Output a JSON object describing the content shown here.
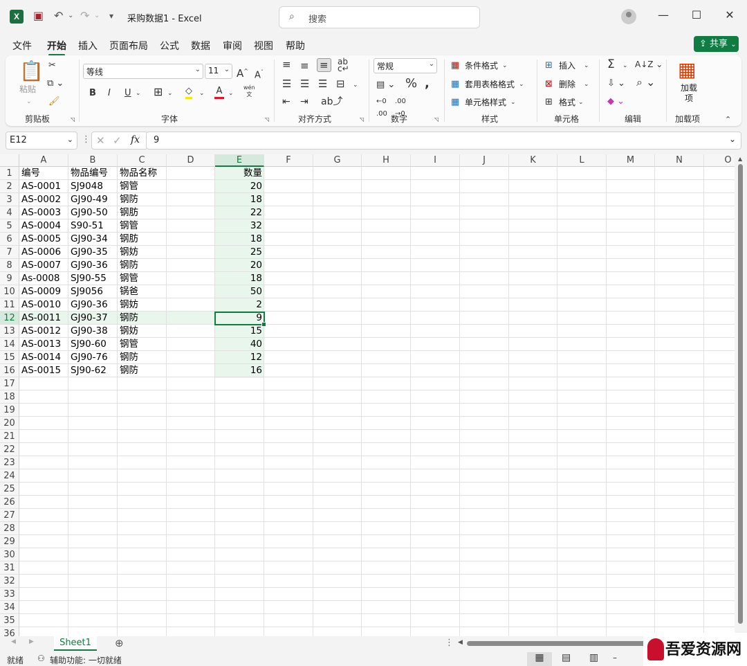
{
  "app": {
    "title": "采购数据1 - Excel",
    "search_placeholder": "搜索"
  },
  "menu": [
    "文件",
    "开始",
    "插入",
    "页面布局",
    "公式",
    "数据",
    "审阅",
    "视图",
    "帮助"
  ],
  "share_label": "共享",
  "ribbon": {
    "clipboard": {
      "paste": "粘贴",
      "label": "剪贴板"
    },
    "font": {
      "name": "等线",
      "size": "11",
      "label": "字体",
      "bold": "B",
      "italic": "I",
      "underline": "U",
      "phonetic": "wén"
    },
    "alignment": {
      "label": "对齐方式"
    },
    "number": {
      "format": "常规",
      "label": "数字"
    },
    "styles": {
      "conditional": "条件格式",
      "table": "套用表格格式",
      "cell_style": "单元格样式",
      "label": "样式"
    },
    "cells": {
      "insert": "插入",
      "delete": "删除",
      "format": "格式",
      "label": "单元格"
    },
    "editing": {
      "label": "编辑"
    },
    "addins": {
      "button": "加载项",
      "label": "加载项"
    }
  },
  "formula_bar": {
    "name_box": "E12",
    "value": "9"
  },
  "columns": [
    "A",
    "B",
    "C",
    "D",
    "E",
    "F",
    "G",
    "H",
    "I",
    "J",
    "K",
    "L",
    "M",
    "N",
    "O"
  ],
  "rows": [
    "1",
    "2",
    "3",
    "4",
    "5",
    "6",
    "7",
    "8",
    "9",
    "10",
    "11",
    "12",
    "13",
    "14",
    "15",
    "16",
    "17",
    "18",
    "19",
    "20",
    "21",
    "22",
    "23",
    "24",
    "25",
    "26",
    "27",
    "28",
    "29",
    "30",
    "31",
    "32",
    "33",
    "34",
    "35",
    "36"
  ],
  "header_row": {
    "a": "编号",
    "b": "物品编号",
    "c": "物品名称",
    "e": "数量"
  },
  "data_rows": [
    {
      "a": "AS-0001",
      "b": "SJ9048",
      "c": "钢管",
      "e": "20"
    },
    {
      "a": "AS-0002",
      "b": "GJ90-49",
      "c": "钢防",
      "e": "18"
    },
    {
      "a": "AS-0003",
      "b": "GJ90-50",
      "c": "钢肪",
      "e": "22"
    },
    {
      "a": "AS-0004",
      "b": "S90-51",
      "c": "钢管",
      "e": "32"
    },
    {
      "a": "AS-0005",
      "b": "GJ90-34",
      "c": "钢肪",
      "e": "18"
    },
    {
      "a": "AS-0006",
      "b": "GJ90-35",
      "c": "钢妨",
      "e": "25"
    },
    {
      "a": "AS-0007",
      "b": "GJ90-36",
      "c": "钢防",
      "e": "20"
    },
    {
      "a": "As-0008",
      "b": "SJ90-55",
      "c": "钢管",
      "e": "18"
    },
    {
      "a": "AS-0009",
      "b": "SJ9056",
      "c": "锅爸",
      "e": "50"
    },
    {
      "a": "AS-0010",
      "b": "GJ90-36",
      "c": "钢妨",
      "e": "2"
    },
    {
      "a": "AS-0011",
      "b": "GJ90-37",
      "c": "钢防",
      "e": "9"
    },
    {
      "a": "AS-0012",
      "b": "GJ90-38",
      "c": "钢妨",
      "e": "15"
    },
    {
      "a": "AS-0013",
      "b": "SJ90-60",
      "c": "钢管",
      "e": "40"
    },
    {
      "a": "AS-0014",
      "b": "GJ90-76",
      "c": "钢防",
      "e": "12"
    },
    {
      "a": "AS-0015",
      "b": "SJ90-62",
      "c": "钢防",
      "e": "16"
    }
  ],
  "sheet_tab": "Sheet1",
  "status": {
    "ready": "就绪",
    "accessibility": "辅助功能: 一切就绪"
  },
  "watermark": "吾爱资源网",
  "colors": {
    "accent": "#107c41",
    "selection_fill": "#e9f6ec"
  }
}
